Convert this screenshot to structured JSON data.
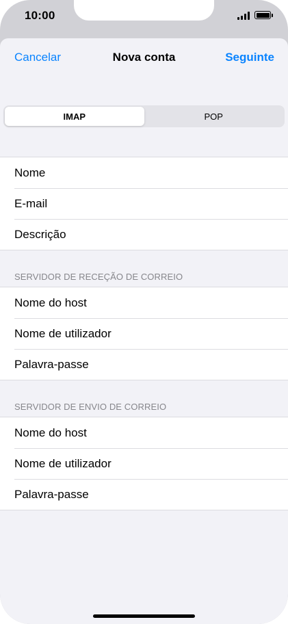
{
  "status_bar": {
    "time": "10:00",
    "signal_icon": "cellular-signal-icon",
    "battery_icon": "battery-icon"
  },
  "navbar": {
    "cancel_label": "Cancelar",
    "title": "Nova conta",
    "next_label": "Seguinte"
  },
  "segmented": {
    "options": [
      "IMAP",
      "POP"
    ],
    "selected": "IMAP"
  },
  "account_fields": {
    "items": [
      {
        "label": "Nome"
      },
      {
        "label": "E-mail"
      },
      {
        "label": "Descrição"
      }
    ]
  },
  "incoming_server": {
    "header": "SERVIDOR DE RECEÇÃO DE CORREIO",
    "items": [
      {
        "label": "Nome do host"
      },
      {
        "label": "Nome de utilizador"
      },
      {
        "label": "Palavra-passe"
      }
    ]
  },
  "outgoing_server": {
    "header": "SERVIDOR DE ENVIO DE CORREIO",
    "items": [
      {
        "label": "Nome do host"
      },
      {
        "label": "Nome de utilizador"
      },
      {
        "label": "Palavra-passe"
      }
    ]
  },
  "colors": {
    "accent": "#0a84ff",
    "background": "#f2f2f7",
    "secondary_text": "#86868b"
  }
}
